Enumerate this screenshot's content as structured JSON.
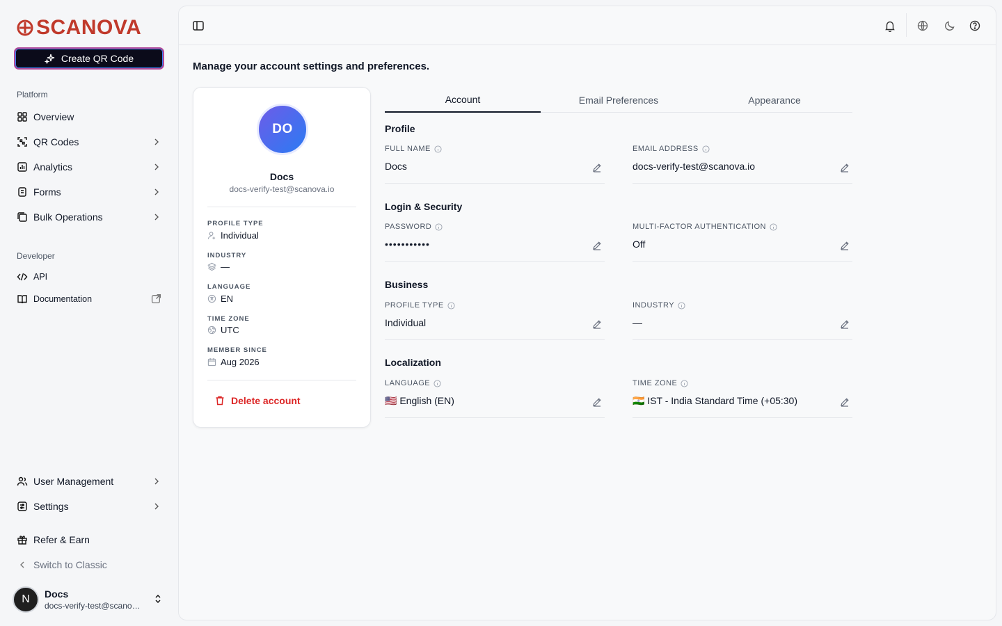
{
  "brand": {
    "name": "SCANOVA",
    "color": "#c0392b"
  },
  "sidebar": {
    "create_button": "Create QR Code",
    "platform_label": "Platform",
    "platform_items": [
      {
        "label": "Overview",
        "icon": "grid-icon"
      },
      {
        "label": "QR Codes",
        "icon": "qr-scan-icon"
      },
      {
        "label": "Analytics",
        "icon": "bar-chart-icon"
      },
      {
        "label": "Forms",
        "icon": "form-icon"
      },
      {
        "label": "Bulk Operations",
        "icon": "stack-icon"
      }
    ],
    "developer_label": "Developer",
    "developer_items": [
      {
        "label": "API",
        "icon": "code-icon"
      },
      {
        "label": "Documentation",
        "icon": "book-icon"
      }
    ],
    "bottom_items": [
      {
        "label": "User Management",
        "icon": "users-icon"
      },
      {
        "label": "Settings",
        "icon": "settings-icon"
      },
      {
        "label": "Refer & Earn",
        "icon": "gift-icon"
      },
      {
        "label": "Switch to Classic",
        "icon": "chevron-left-icon"
      }
    ],
    "user": {
      "initial": "N",
      "name": "Docs",
      "email": "docs-verify-test@scanova.io"
    }
  },
  "header": {
    "subtitle": "Manage your account settings and preferences."
  },
  "profile_card": {
    "initials": "DO",
    "name": "Docs",
    "email": "docs-verify-test@scanova.io",
    "details": [
      {
        "label": "PROFILE TYPE",
        "value": "Individual",
        "icon": "user-icon"
      },
      {
        "label": "INDUSTRY",
        "value": "—",
        "icon": "layers-icon"
      },
      {
        "label": "LANGUAGE",
        "value": "EN",
        "icon": "language-icon"
      },
      {
        "label": "TIME ZONE",
        "value": "UTC",
        "icon": "globe-icon"
      },
      {
        "label": "MEMBER SINCE",
        "value": "Aug 2026",
        "icon": "calendar-icon"
      }
    ],
    "delete_label": "Delete account"
  },
  "tabs": [
    "Account",
    "Email Preferences",
    "Appearance"
  ],
  "sections": {
    "profile": {
      "title": "Profile",
      "full_name_label": "FULL NAME",
      "full_name": "Docs",
      "email_label": "EMAIL ADDRESS",
      "email": "docs-verify-test@scanova.io"
    },
    "security": {
      "title": "Login & Security",
      "password_label": "PASSWORD",
      "password": "•••••••••••",
      "mfa_label": "MULTI-FACTOR AUTHENTICATION",
      "mfa": "Off"
    },
    "business": {
      "title": "Business",
      "profile_type_label": "PROFILE TYPE",
      "profile_type": "Individual",
      "industry_label": "INDUSTRY",
      "industry": "—"
    },
    "localization": {
      "title": "Localization",
      "language_label": "LANGUAGE",
      "language": "🇺🇸 English (EN)",
      "timezone_label": "TIME ZONE",
      "timezone": "🇮🇳 IST - India Standard Time (+05:30)"
    }
  }
}
